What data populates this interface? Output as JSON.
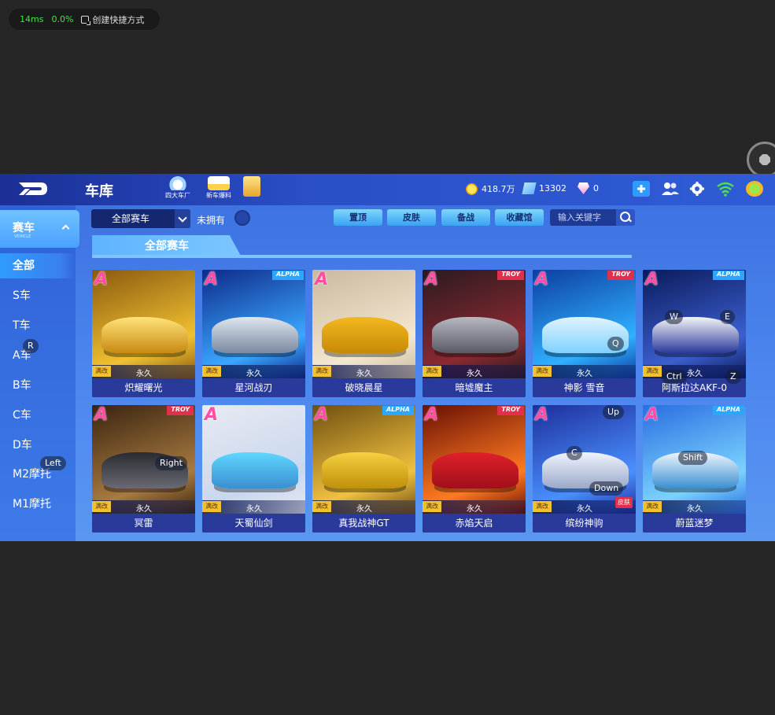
{
  "overlay": {
    "latency": "14ms",
    "cpu": "0.0%",
    "shortcut_label": "创建快捷方式"
  },
  "topbar": {
    "title": "车库",
    "nav": [
      {
        "label": "四大车厂"
      },
      {
        "label": "新车爆料"
      },
      {
        "label": ""
      }
    ],
    "coins": "418.7万",
    "diamonds": "13302",
    "gems": "0"
  },
  "sidebar": {
    "category": "赛车",
    "category_sub": "VEHICLE",
    "items": [
      "全部",
      "S车",
      "T车",
      "A车",
      "B车",
      "C车",
      "D车",
      "M2摩托",
      "M1摩托"
    ]
  },
  "filter": {
    "dropdown": "全部赛车",
    "not_owned": "未拥有",
    "buttons": [
      "置顶",
      "皮肤",
      "备战",
      "收藏馆"
    ],
    "search_placeholder": "输入关键字"
  },
  "section_title": "全部赛车",
  "cars": [
    {
      "grade": "A",
      "brand": "",
      "name": "炽耀曙光",
      "mod": "满改",
      "duration": "永久"
    },
    {
      "grade": "A",
      "brand": "ALPHA",
      "name": "星河战刃",
      "mod": "满改",
      "duration": "永久"
    },
    {
      "grade": "A",
      "brand": "",
      "name": "破晓晨星",
      "mod": "满改",
      "duration": "永久"
    },
    {
      "grade": "A",
      "brand": "TROY",
      "name": "暗墟魔主",
      "mod": "满改",
      "duration": "永久"
    },
    {
      "grade": "A",
      "brand": "TROY",
      "name": "神影 雪音",
      "mod": "满改",
      "duration": "永久"
    },
    {
      "grade": "A",
      "brand": "ALPHA",
      "name": "阿斯拉达AKF-0",
      "mod": "满改",
      "duration": "永久"
    },
    {
      "grade": "A",
      "brand": "TROY",
      "name": "冥雷",
      "mod": "满改",
      "duration": "永久"
    },
    {
      "grade": "A",
      "brand": "",
      "name": "天蜀仙剑",
      "mod": "满改",
      "duration": "永久"
    },
    {
      "grade": "A",
      "brand": "ALPHA",
      "name": "真我战神GT",
      "mod": "满改",
      "duration": "永久"
    },
    {
      "grade": "A",
      "brand": "TROY",
      "name": "赤焰天启",
      "mod": "满改",
      "duration": "永久"
    },
    {
      "grade": "A",
      "brand": "",
      "name": "缤纷神驹",
      "mod": "满改",
      "duration": "永久",
      "skin": "皮肤"
    },
    {
      "grade": "A",
      "brand": "ALPHA",
      "name": "蔚蓝迷梦",
      "mod": "满改",
      "duration": "永久"
    }
  ],
  "key_hints": [
    "R",
    "Left",
    "Right",
    "W",
    "E",
    "Q",
    "Ctrl",
    "Z",
    "Up",
    "C",
    "Down",
    "Shift"
  ]
}
